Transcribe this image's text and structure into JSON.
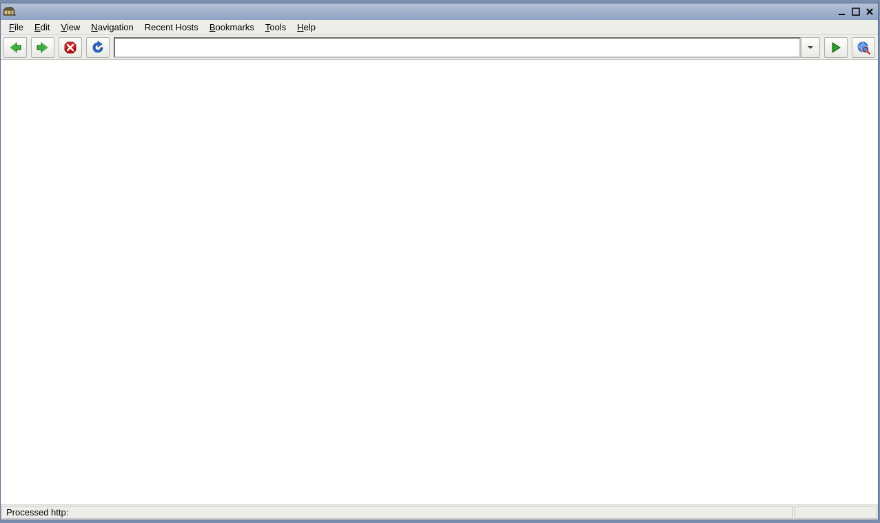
{
  "title": " ",
  "menu": {
    "file": "File",
    "edit": "Edit",
    "view": "View",
    "navigation": "Navigation",
    "recent_hosts": "Recent Hosts",
    "bookmarks": "Bookmarks",
    "tools": "Tools",
    "help": "Help"
  },
  "toolbar": {
    "url_value": "",
    "url_placeholder": ""
  },
  "status": {
    "text": "Processed http:"
  }
}
